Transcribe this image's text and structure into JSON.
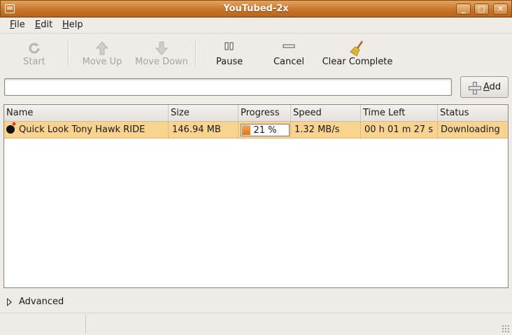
{
  "window": {
    "title": "YouTubed-2x"
  },
  "menu": [
    {
      "label": "File",
      "mnemonic": "F",
      "rest": "ile"
    },
    {
      "label": "Edit",
      "mnemonic": "E",
      "rest": "dit"
    },
    {
      "label": "Help",
      "mnemonic": "H",
      "rest": "elp"
    }
  ],
  "toolbar": {
    "start": "Start",
    "move_up": "Move Up",
    "move_down": "Move Down",
    "pause": "Pause",
    "cancel": "Cancel",
    "clear_complete": "Clear Complete"
  },
  "url_field": {
    "value": ""
  },
  "add_button": {
    "mnemonic": "A",
    "rest": "dd"
  },
  "columns": [
    "Name",
    "Size",
    "Progress",
    "Speed",
    "Time Left",
    "Status"
  ],
  "downloads": [
    {
      "name": "Quick Look Tony Hawk RIDE",
      "size": "146.94 MB",
      "progress": 21,
      "progress_text": "21 %",
      "speed": "1.32 MB/s",
      "time_left": "00 h 01 m 27 s",
      "status": "Downloading"
    }
  ],
  "advanced_label": "Advanced",
  "colors": {
    "titlebar": "#c8762b",
    "selected_row": "#fad391",
    "progress_fill": "#e0731e"
  }
}
